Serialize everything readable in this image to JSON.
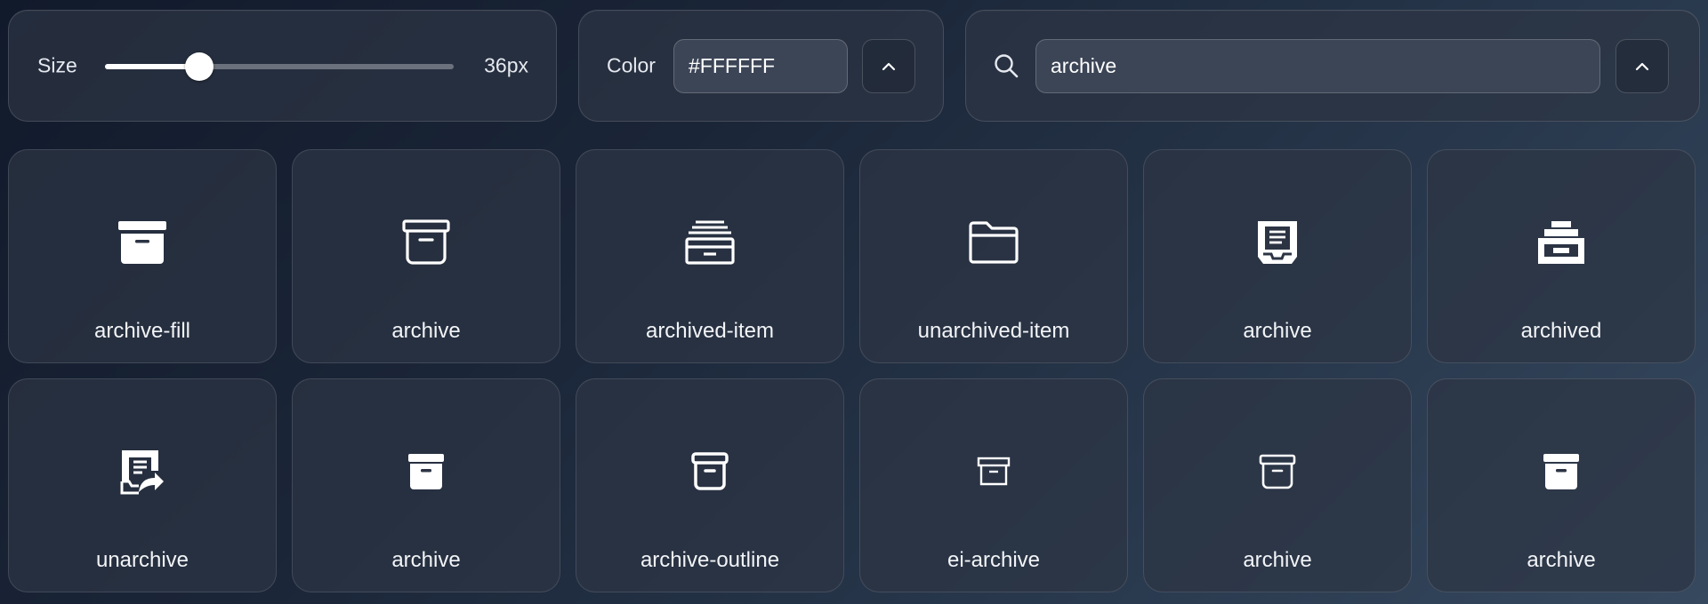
{
  "controls": {
    "size": {
      "label": "Size",
      "value_text": "36px",
      "level": 0.27
    },
    "color": {
      "label": "Color",
      "value": "#FFFFFF"
    },
    "search": {
      "value": "archive"
    }
  },
  "icons": [
    {
      "name": "archive-fill",
      "icon": "archive-fill-icon"
    },
    {
      "name": "archive",
      "icon": "archive-outline-icon"
    },
    {
      "name": "archived-item",
      "icon": "archived-item-icon"
    },
    {
      "name": "unarchived-item",
      "icon": "folder-icon"
    },
    {
      "name": "archive",
      "icon": "document-tray-icon"
    },
    {
      "name": "archived",
      "icon": "archive-drawer-icon"
    },
    {
      "name": "unarchive",
      "icon": "unarchive-icon"
    },
    {
      "name": "archive",
      "icon": "archive-fill-small-icon"
    },
    {
      "name": "archive-outline",
      "icon": "archive-outline-thick-icon"
    },
    {
      "name": "ei-archive",
      "icon": "archive-thin-icon"
    },
    {
      "name": "archive",
      "icon": "archive-outline-small-icon"
    },
    {
      "name": "archive",
      "icon": "archive-fill-small-icon"
    }
  ]
}
